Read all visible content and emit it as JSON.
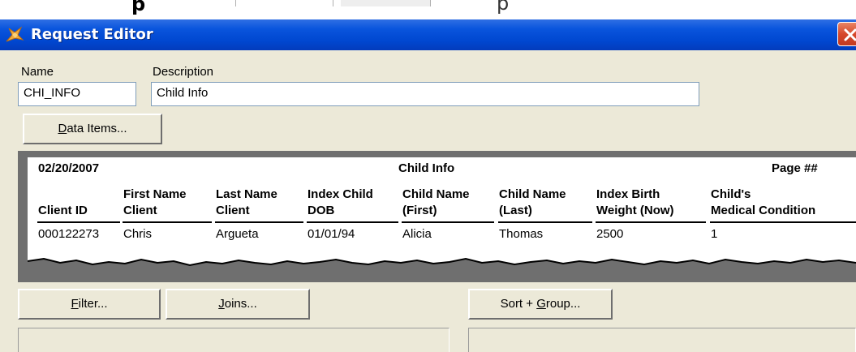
{
  "background_strip": {
    "bold_fragment": "p",
    "light_fragment": "p"
  },
  "window": {
    "title": "Request Editor"
  },
  "form": {
    "name_label": "Name",
    "name_value": "CHI_INFO",
    "description_label": "Description",
    "description_value": "Child Info",
    "data_items_button": {
      "mnemonic": "D",
      "rest": "ata Items..."
    }
  },
  "report": {
    "date": "02/20/2007",
    "title": "Child Info",
    "page": "Page ##",
    "columns": [
      {
        "line1": "",
        "line2": "Client ID"
      },
      {
        "line1": "First Name",
        "line2": "Client"
      },
      {
        "line1": "Last Name",
        "line2": "Client"
      },
      {
        "line1": "Index Child",
        "line2": "DOB"
      },
      {
        "line1": "Child Name",
        "line2": "(First)"
      },
      {
        "line1": "Child Name",
        "line2": "(Last)"
      },
      {
        "line1": "Index Birth",
        "line2": "Weight (Now)"
      },
      {
        "line1": "Child's",
        "line2": "Medical Condition"
      }
    ],
    "row": [
      "000122273",
      "Chris",
      "Argueta",
      "01/01/94",
      "Alicia",
      "Thomas",
      "2500",
      "1"
    ]
  },
  "buttons": {
    "filter": {
      "mnemonic": "F",
      "rest": "ilter..."
    },
    "joins": {
      "mnemonic": "J",
      "rest": "oins..."
    },
    "sort_group": {
      "before": "Sort + ",
      "mnemonic": "G",
      "rest": "roup..."
    }
  },
  "colors": {
    "titlebar": "#0047d0",
    "dialog_bg": "#ece9d8",
    "preview_frame": "#6f6f6f"
  }
}
